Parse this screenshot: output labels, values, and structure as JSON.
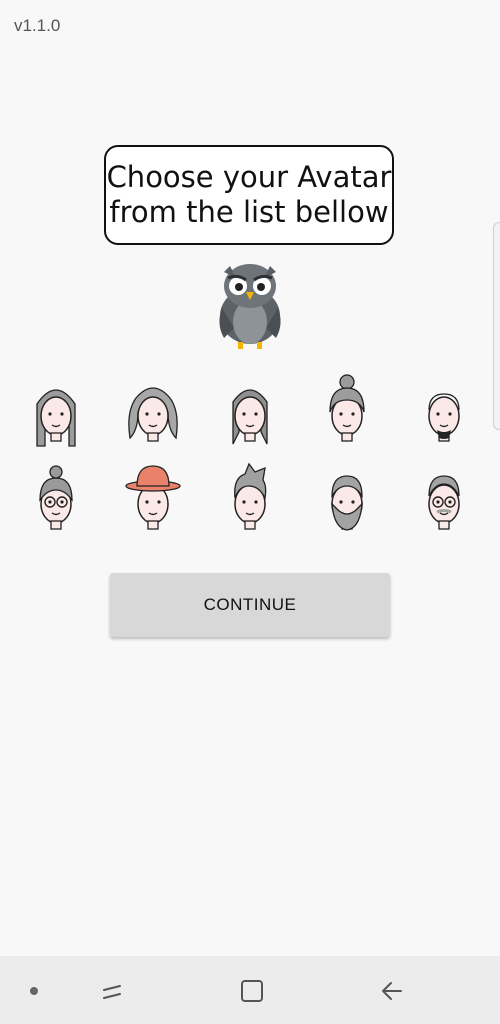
{
  "app": {
    "version": "v1.1.0"
  },
  "prompt": {
    "line1": "Choose your Avatar",
    "line2": "from the list bellow"
  },
  "mascot": {
    "icon": "owl-icon"
  },
  "avatars": [
    {
      "name": "woman-long-straight-hair",
      "hair": "#9b9b9b"
    },
    {
      "name": "woman-curly-hair",
      "hair": "#a7a7a7"
    },
    {
      "name": "woman-dark-long-hair",
      "hair": "#8f8f8f"
    },
    {
      "name": "older-woman-bun",
      "hair": "#9c9c9c"
    },
    {
      "name": "bald-man",
      "hair": "#f3e3df"
    },
    {
      "name": "woman-bun-glasses",
      "hair": "#9a9a9a"
    },
    {
      "name": "man-orange-hat",
      "hair": "#e8826a"
    },
    {
      "name": "man-spiky-hair",
      "hair": "#a0a0a0"
    },
    {
      "name": "bearded-man",
      "hair": "#a3a3a3"
    },
    {
      "name": "older-man-glasses",
      "hair": "#a3a3a3"
    }
  ],
  "actions": {
    "continue_label": "CONTINUE"
  },
  "system_nav": {
    "items": [
      "recent-apps-icon",
      "home-icon",
      "back-icon"
    ]
  },
  "colors": {
    "skin": "#fbe9e7",
    "outline": "#222222",
    "button_bg": "#d8d8d8",
    "background": "#f8f8f8"
  }
}
